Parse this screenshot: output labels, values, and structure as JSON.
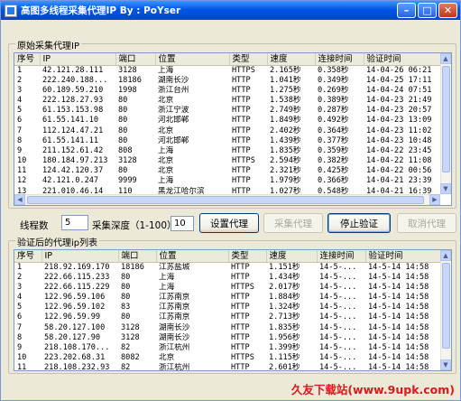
{
  "window": {
    "title": "高图多线程采集代理IP  By : PoYser"
  },
  "source_group": {
    "label": "原始采集代理IP",
    "columns": [
      "序号",
      "IP",
      "端口",
      "位置",
      "类型",
      "速度",
      "连接时间",
      "验证时间"
    ],
    "rows": [
      [
        "1",
        "42.121.28.111",
        "3128",
        "上海",
        "HTTPS",
        "2.165秒",
        "0.358秒",
        "14-04-26 06:21"
      ],
      [
        "2",
        "222.240.188...",
        "18186",
        "湖南长沙",
        "HTTP",
        "1.041秒",
        "0.349秒",
        "14-04-25 17:11"
      ],
      [
        "3",
        "60.189.59.210",
        "1998",
        "浙江台州",
        "HTTP",
        "1.275秒",
        "0.269秒",
        "14-04-24 07:51"
      ],
      [
        "4",
        "222.128.27.93",
        "80",
        "北京",
        "HTTP",
        "1.538秒",
        "0.389秒",
        "14-04-23 21:49"
      ],
      [
        "5",
        "61.153.153.98",
        "80",
        "浙江宁波",
        "HTTP",
        "2.749秒",
        "0.287秒",
        "14-04-23 20:57"
      ],
      [
        "6",
        "61.55.141.10",
        "80",
        "河北邯郸",
        "HTTP",
        "1.849秒",
        "0.492秒",
        "14-04-23 13:09"
      ],
      [
        "7",
        "112.124.47.21",
        "80",
        "北京",
        "HTTP",
        "2.402秒",
        "0.364秒",
        "14-04-23 11:02"
      ],
      [
        "8",
        "61.55.141.11",
        "80",
        "河北邯郸",
        "HTTP",
        "1.439秒",
        "0.377秒",
        "14-04-23 10:48"
      ],
      [
        "9",
        "211.152.61.42",
        "808",
        "上海",
        "HTTP",
        "1.835秒",
        "0.359秒",
        "14-04-22 23:45"
      ],
      [
        "10",
        "180.184.97.213",
        "3128",
        "北京",
        "HTTPS",
        "2.594秒",
        "0.382秒",
        "14-04-22 11:08"
      ],
      [
        "11",
        "124.42.120.37",
        "80",
        "北京",
        "HTTP",
        "2.321秒",
        "0.425秒",
        "14-04-22 00:56"
      ],
      [
        "12",
        "42.121.0.247",
        "9999",
        "上海",
        "HTTP",
        "1.979秒",
        "0.366秒",
        "14-04-21 23:39"
      ],
      [
        "13",
        "221.010.46.14",
        "110",
        "黑龙江哈尔滨",
        "HTTP",
        "1.027秒",
        "0.548秒",
        "14-04-21 16:39"
      ]
    ]
  },
  "controls": {
    "threads_label": "线程数",
    "threads_value": "5",
    "depth_label": "采集深度（1-100）",
    "depth_value": "10",
    "btn_set_proxy": "设置代理",
    "btn_collect": "采集代理",
    "btn_stop_verify": "停止验证",
    "btn_cancel_proxy": "取消代理"
  },
  "verified_group": {
    "label": "验证后的代理ip列表",
    "columns": [
      "序号",
      "IP",
      "端口",
      "位置",
      "类型",
      "速度",
      "连接时间",
      "验证时间"
    ],
    "rows": [
      [
        "1",
        "218.92.169.170",
        "18186",
        "江苏盐城",
        "HTTP",
        "1.151秒",
        "14-5-...",
        "14-5-14  14:58"
      ],
      [
        "2",
        "222.66.115.233",
        "80",
        "上海",
        "HTTP",
        "1.434秒",
        "14-5-...",
        "14-5-14  14:58"
      ],
      [
        "3",
        "222.66.115.229",
        "80",
        "上海",
        "HTTPS",
        "2.017秒",
        "14-5-...",
        "14-5-14  14:58"
      ],
      [
        "4",
        "122.96.59.106",
        "80",
        "江苏南京",
        "HTTP",
        "1.884秒",
        "14-5-...",
        "14-5-14  14:58"
      ],
      [
        "5",
        "122.96.59.102",
        "83",
        "江苏南京",
        "HTTP",
        "1.324秒",
        "14-5-...",
        "14-5-14  14:58"
      ],
      [
        "6",
        "122.96.59.99",
        "80",
        "江苏南京",
        "HTTP",
        "2.713秒",
        "14-5-...",
        "14-5-14  14:58"
      ],
      [
        "7",
        "58.20.127.100",
        "3128",
        "湖南长沙",
        "HTTP",
        "1.835秒",
        "14-5-...",
        "14-5-14  14:58"
      ],
      [
        "8",
        "58.20.127.90",
        "3128",
        "湖南长沙",
        "HTTP",
        "1.956秒",
        "14-5-...",
        "14-5-14  14:58"
      ],
      [
        "9",
        "218.108.170...",
        "82",
        "浙江杭州",
        "HTTP",
        "1.399秒",
        "14-5-...",
        "14-5-14  14:58"
      ],
      [
        "10",
        "223.202.68.31",
        "8082",
        "北京",
        "HTTPS",
        "1.115秒",
        "14-5-...",
        "14-5-14  14:58"
      ],
      [
        "11",
        "218.108.232.93",
        "82",
        "浙江杭州",
        "HTTP",
        "2.601秒",
        "14-5-...",
        "14-5-14  14:58"
      ]
    ]
  },
  "watermark": "久友下载站(www.9upk.com)"
}
